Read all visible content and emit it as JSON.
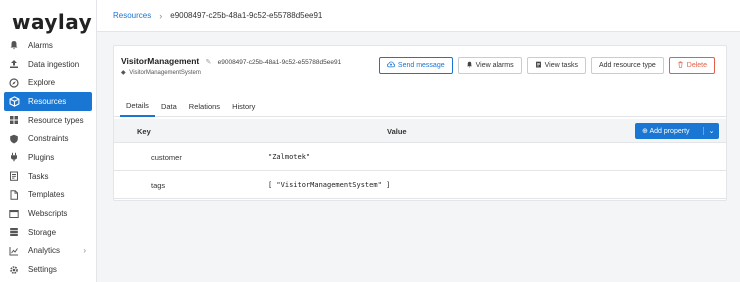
{
  "app": {
    "logo": "waylay"
  },
  "sidebar": {
    "items": [
      {
        "label": "Alarms",
        "icon": "bell-icon"
      },
      {
        "label": "Data ingestion",
        "icon": "upload-icon"
      },
      {
        "label": "Explore",
        "icon": "compass-icon"
      },
      {
        "label": "Resources",
        "icon": "cube-icon",
        "active": true
      },
      {
        "label": "Resource types",
        "icon": "grid-icon"
      },
      {
        "label": "Constraints",
        "icon": "shield-icon"
      },
      {
        "label": "Plugins",
        "icon": "plug-icon"
      },
      {
        "label": "Tasks",
        "icon": "tasks-icon"
      },
      {
        "label": "Templates",
        "icon": "template-icon"
      },
      {
        "label": "Webscripts",
        "icon": "code-icon"
      },
      {
        "label": "Storage",
        "icon": "database-icon"
      },
      {
        "label": "Analytics",
        "icon": "chart-icon",
        "caret": "›"
      },
      {
        "label": "Settings",
        "icon": "gear-icon"
      }
    ]
  },
  "breadcrumb": {
    "link": "Resources",
    "separator": "›",
    "current": "e9008497-c25b-48a1-9c52-e55788d5ee91"
  },
  "resource": {
    "name": "VisitorManagement",
    "id": "e9008497-c25b-48a1-9c52-e55788d5ee91",
    "type": "VisitorManagementSystem"
  },
  "actions": {
    "send_message": "Send message",
    "view_alarms": "View alarms",
    "view_tasks": "View tasks",
    "add_resource_type": "Add resource type",
    "delete": "Delete"
  },
  "tabs": [
    "Details",
    "Data",
    "Relations",
    "History"
  ],
  "properties": {
    "key_header": "Key",
    "value_header": "Value",
    "add_label": "Add property",
    "rows": [
      {
        "key": "customer",
        "value": "\"Zalmotek\""
      },
      {
        "key": "tags",
        "value": "[ \"VisitorManagementSystem\" ]"
      }
    ]
  },
  "colors": {
    "accent": "#1976d2",
    "danger": "#e0604a"
  }
}
